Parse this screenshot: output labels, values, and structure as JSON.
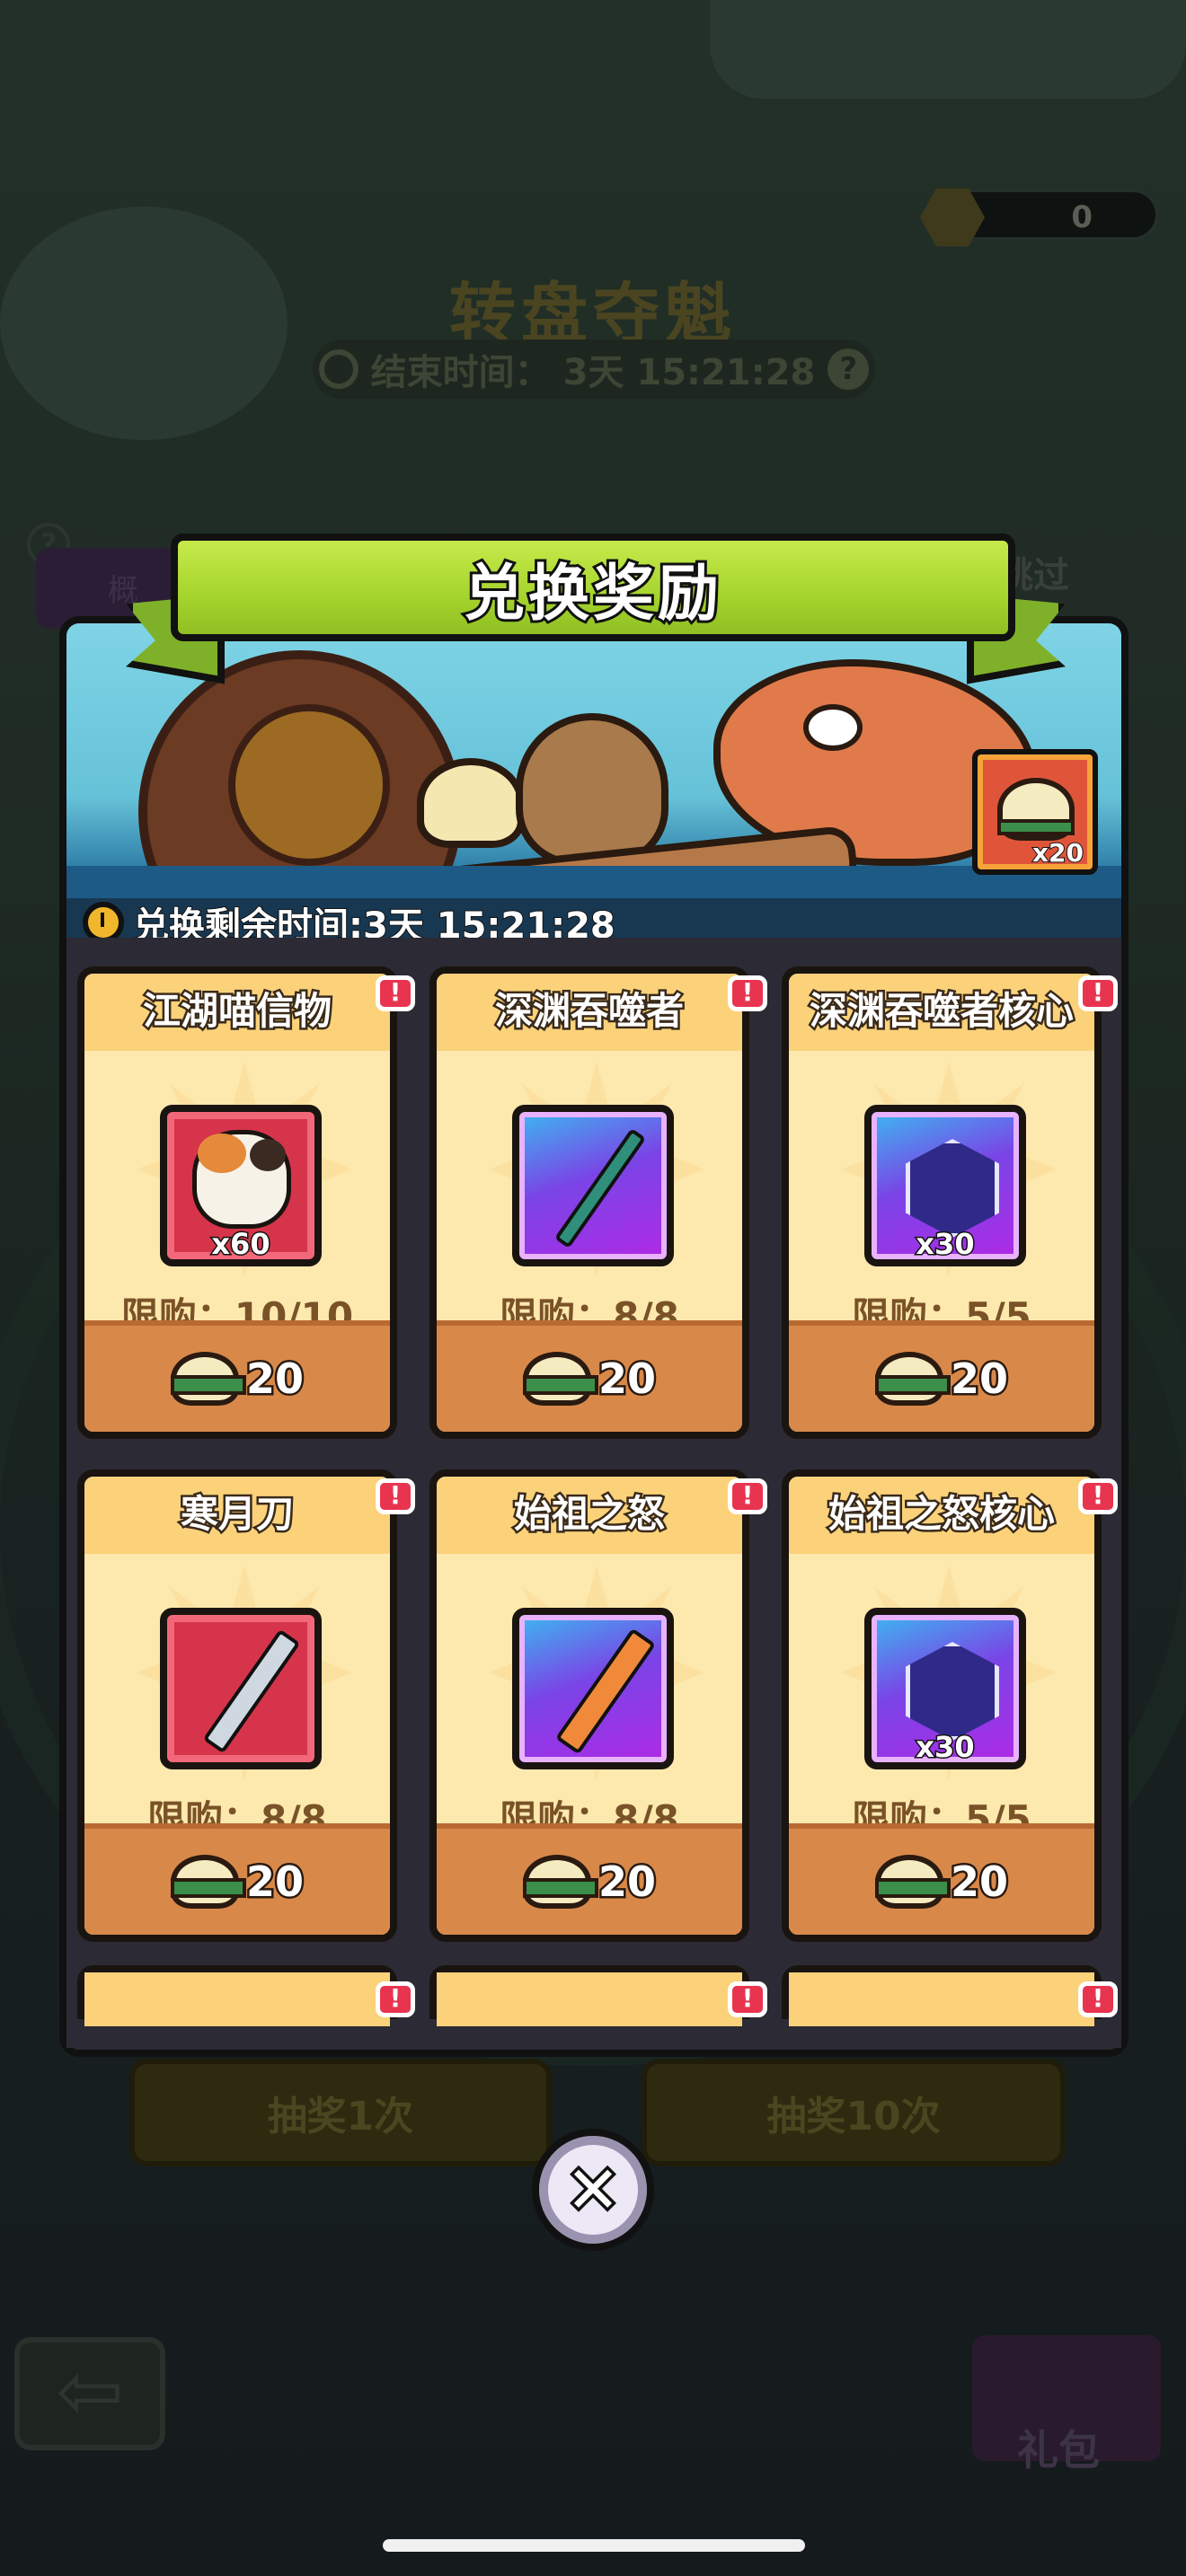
{
  "background": {
    "coin_value": "0",
    "event_title": "转盘夺魁",
    "event_timer_label": "结束时间：",
    "event_timer_value": "3天 15:21:28",
    "tab_left": "概",
    "skip_label": "跳过",
    "draw_once": "抽奖1次",
    "draw_ten": "抽奖10次",
    "gift_label": "礼包"
  },
  "modal": {
    "title": "兑换奖励",
    "banner_reward_count": "x20",
    "timer_text": "兑换剩余时间:3天 15:21:28",
    "badge_text": "!",
    "items": [
      {
        "name": "江湖喵信物",
        "icon": "calico-cat-icon",
        "count": "x60",
        "limit": "限购：10/10",
        "price": "20",
        "frame": "red"
      },
      {
        "name": "深渊吞噬者",
        "icon": "green-sword-icon",
        "count": "",
        "limit": "限购：8/8",
        "price": "20",
        "frame": "purple"
      },
      {
        "name": "深渊吞噬者核心",
        "icon": "sword-core-gem-icon",
        "count": "x30",
        "limit": "限购：5/5",
        "price": "20",
        "frame": "purple"
      },
      {
        "name": "寒月刀",
        "icon": "curved-blade-icon",
        "count": "",
        "limit": "限购：8/8",
        "price": "20",
        "frame": "red"
      },
      {
        "name": "始祖之怒",
        "icon": "flame-sword-icon",
        "count": "",
        "limit": "限购：8/8",
        "price": "20",
        "frame": "purple"
      },
      {
        "name": "始祖之怒核心",
        "icon": "flame-core-gem-icon",
        "count": "x30",
        "limit": "限购：5/5",
        "price": "20",
        "frame": "purple"
      }
    ],
    "close_label": "✕"
  },
  "colors": {
    "ribbon_green": "#a6d42e",
    "card_cream": "#fde9ad",
    "price_orange": "#d8894a",
    "badge_red": "#e8344f"
  }
}
